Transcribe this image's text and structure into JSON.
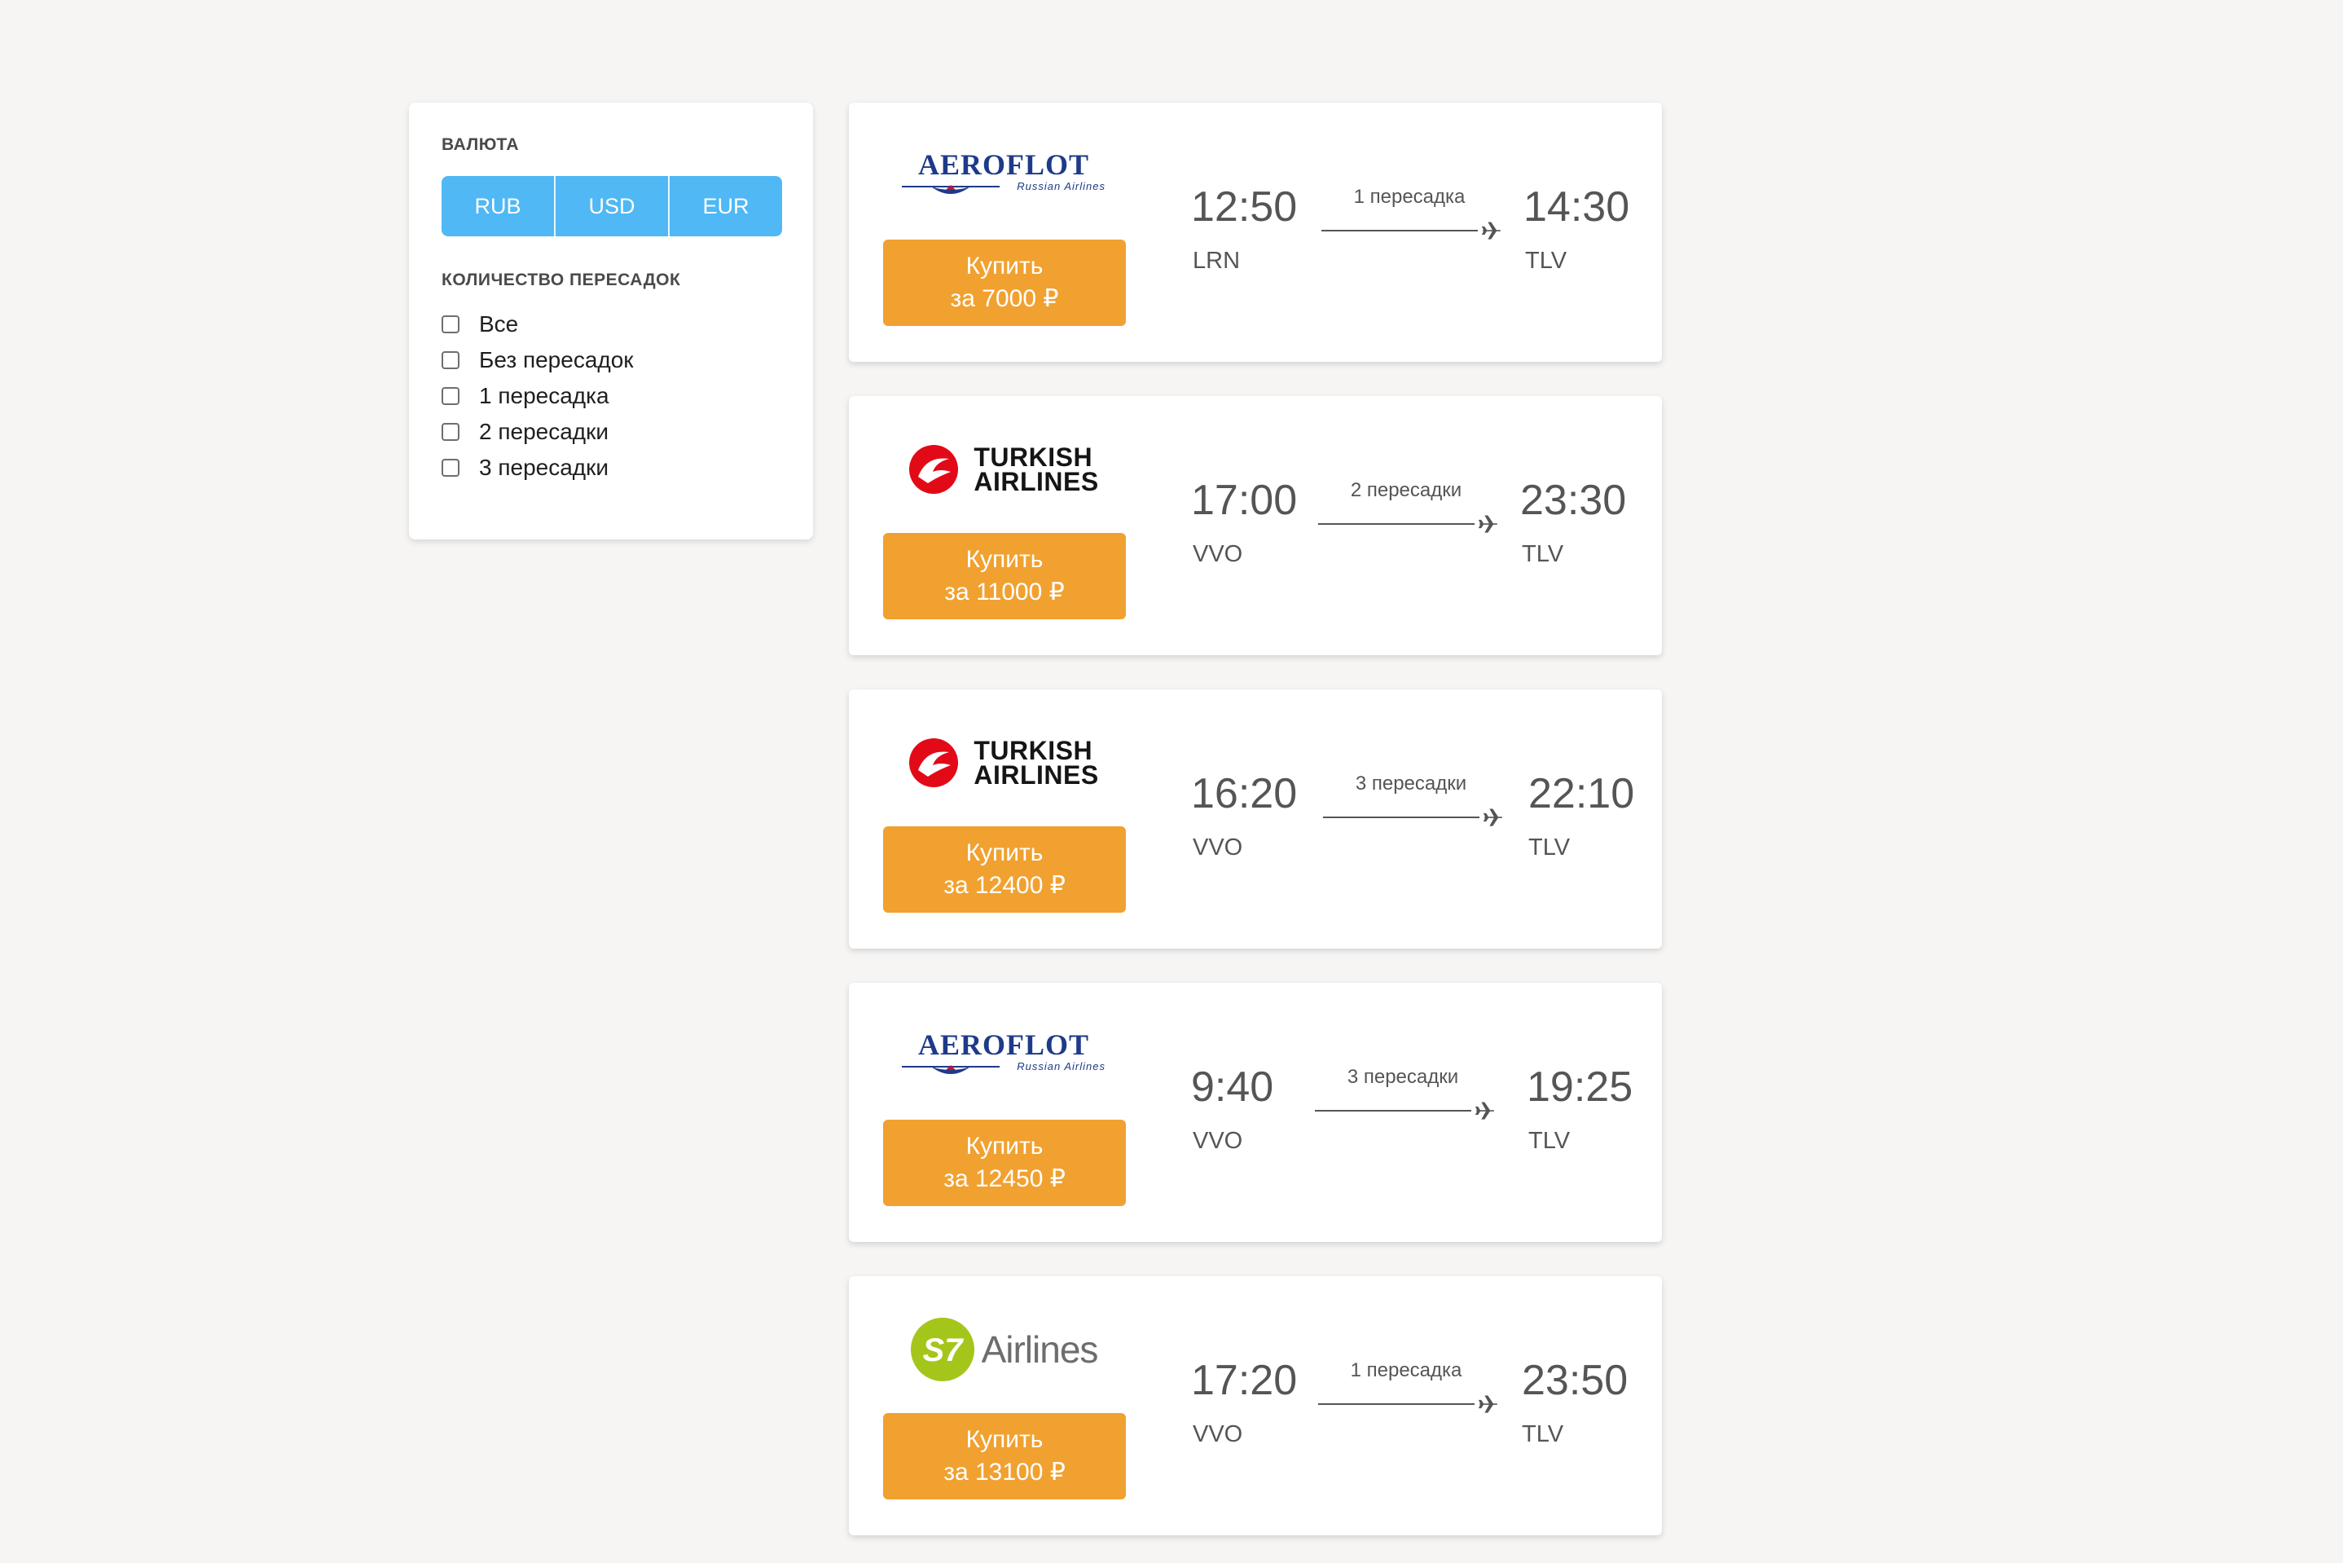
{
  "filter": {
    "currency_title": "ВАЛЮТА",
    "currencies": [
      "RUB",
      "USD",
      "EUR"
    ],
    "stops_title": "КОЛИЧЕСТВО ПЕРЕСАДОК",
    "stop_options": [
      "Все",
      "Без пересадок",
      "1 пересадка",
      "2 пересадки",
      "3 пересадки"
    ]
  },
  "colors": {
    "accent_currency": "#4fb8f5",
    "buy_button": "#f1a130",
    "background": "#f6f5f4"
  },
  "tickets": [
    {
      "airline": "Aeroflot",
      "logo_text": "AEROFLOT",
      "logo_sub": "Russian Airlines",
      "buy_line1": "Купить",
      "buy_line2": "за 7000 ₽",
      "dep_time": "12:50",
      "dep_code": "LRN",
      "arr_time": "14:30",
      "arr_code": "TLV",
      "stops": "1 пересадка"
    },
    {
      "airline": "Turkish Airlines",
      "logo_text_1": "TURKISH",
      "logo_text_2": "AIRLINES",
      "buy_line1": "Купить",
      "buy_line2": "за 11000 ₽",
      "dep_time": "17:00",
      "dep_code": "VVO",
      "arr_time": "23:30",
      "arr_code": "TLV",
      "stops": "2 пересадки"
    },
    {
      "airline": "Turkish Airlines",
      "logo_text_1": "TURKISH",
      "logo_text_2": "AIRLINES",
      "buy_line1": "Купить",
      "buy_line2": "за 12400 ₽",
      "dep_time": "16:20",
      "dep_code": "VVO",
      "arr_time": "22:10",
      "arr_code": "TLV",
      "stops": "3 пересадки"
    },
    {
      "airline": "Aeroflot",
      "logo_text": "AEROFLOT",
      "logo_sub": "Russian Airlines",
      "buy_line1": "Купить",
      "buy_line2": "за 12450 ₽",
      "dep_time": "9:40",
      "dep_code": "VVO",
      "arr_time": "19:25",
      "arr_code": "TLV",
      "stops": "3 пересадки"
    },
    {
      "airline": "S7 Airlines",
      "logo_mark": "S7",
      "logo_text": "Airlines",
      "buy_line1": "Купить",
      "buy_line2": "за 13100 ₽",
      "dep_time": "17:20",
      "dep_code": "VVO",
      "arr_time": "23:50",
      "arr_code": "TLV",
      "stops": "1 пересадка"
    }
  ]
}
